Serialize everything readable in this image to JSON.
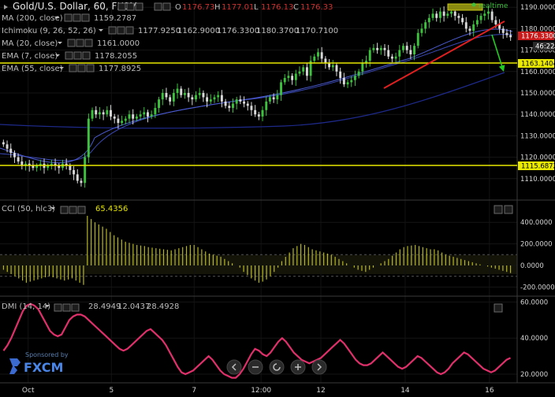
{
  "header": {
    "symbol": "Gold/U.S. Dollar, 60, FXCM",
    "ohlc": [
      {
        "key": "O",
        "value": "1176.73"
      },
      {
        "key": "H",
        "value": "1177.01"
      },
      {
        "key": "L",
        "value": "1176.13"
      },
      {
        "key": "C",
        "value": "1176.33"
      }
    ],
    "realtime_label": "realtime"
  },
  "indicators": [
    {
      "label": "MA (200, close)",
      "values": [
        "1159.2787"
      ],
      "colors": [
        "#4a7fd0"
      ]
    },
    {
      "label": "Ichimoku (9, 26, 52, 26)",
      "values": [
        "1177.9250",
        "1162.9000",
        "1176.3300",
        "1180.3700",
        "1170.7100"
      ],
      "colors": [
        "#4a7fd0",
        "#d03030",
        "#3cc23c",
        "#3cc23c",
        "#d03030"
      ]
    },
    {
      "label": "MA (20, close)",
      "values": [
        "1161.0000"
      ],
      "colors": [
        "#4a7fd0"
      ]
    },
    {
      "label": "EMA (7, close)",
      "values": [
        "1178.2055"
      ],
      "colors": [
        "#4a7fd0"
      ]
    },
    {
      "label": "EMA (55, close)",
      "values": [
        "1177.8925"
      ],
      "colors": [
        "#4a7fd0"
      ]
    }
  ],
  "price_axis": {
    "ticks": [
      "1190.0000",
      "1180.0000",
      "1170.0000",
      "1160.0000",
      "1150.0000",
      "1140.0000",
      "1130.0000",
      "1120.0000",
      "1110.0000"
    ],
    "current_price": "1176.3300",
    "countdown": "46:22",
    "hline_upper": "1163.1404",
    "hline_lower": "1115.6872"
  },
  "cci": {
    "label": "CCI (50, hlc3)",
    "value": "65.4356",
    "ticks": [
      "400.0000",
      "200.0000",
      "0.0000",
      "-200.0000"
    ]
  },
  "dmi": {
    "label": "DMI (14, 14)",
    "values": [
      "28.4949",
      "12.0437",
      "28.4928"
    ],
    "colors": [
      "#e0306c",
      "#4a7fd0",
      "#e88a2a"
    ],
    "ticks": [
      "60.0000",
      "40.0000",
      "20.0000"
    ]
  },
  "x_axis": {
    "ticks": [
      "Oct",
      "5",
      "7",
      "12:00",
      "12",
      "14",
      "16"
    ]
  },
  "sponsor": {
    "text": "Sponsored by",
    "brand": "FXCM"
  },
  "colors": {
    "up_candle": "#3cc23c",
    "down_candle": "#d8d8d8",
    "hline": "#e8e800",
    "trendline": "#e02020",
    "arrow": "#22cc22",
    "dmi_line": "#e0306c",
    "cci_bars": "#b8b81e"
  },
  "chart_data": [
    {
      "type": "candlestick",
      "title": "Gold/U.S. Dollar, 60, FXCM",
      "ylim": [
        1104,
        1193
      ],
      "x": [
        "Oct",
        "5",
        "7",
        "12:00",
        "12",
        "14",
        "16"
      ],
      "close": [
        1126,
        1124,
        1122,
        1120,
        1118,
        1116,
        1117,
        1116,
        1115,
        1116,
        1117,
        1115,
        1116,
        1117,
        1116,
        1115,
        1117,
        1116,
        1114,
        1112,
        1109,
        1108,
        1120,
        1138,
        1142,
        1140,
        1141,
        1140,
        1142,
        1139,
        1138,
        1136,
        1137,
        1138,
        1140,
        1138,
        1139,
        1140,
        1141,
        1139,
        1140,
        1143,
        1147,
        1150,
        1148,
        1146,
        1150,
        1152,
        1149,
        1150,
        1148,
        1147,
        1149,
        1150,
        1148,
        1146,
        1147,
        1148,
        1149,
        1146,
        1144,
        1143,
        1145,
        1147,
        1146,
        1145,
        1144,
        1142,
        1140,
        1139,
        1142,
        1146,
        1148,
        1147,
        1149,
        1155,
        1157,
        1158,
        1156,
        1159,
        1160,
        1162,
        1158,
        1165,
        1167,
        1169,
        1166,
        1164,
        1162,
        1163,
        1160,
        1157,
        1154,
        1155,
        1156,
        1158,
        1160,
        1164,
        1165,
        1170,
        1171,
        1170,
        1171,
        1170,
        1167,
        1166,
        1167,
        1170,
        1172,
        1170,
        1168,
        1172,
        1178,
        1180,
        1183,
        1185,
        1187,
        1185,
        1188,
        1186,
        1187,
        1188,
        1186,
        1185,
        1183,
        1180,
        1179,
        1182,
        1184,
        1186,
        1187,
        1188,
        1184,
        1182,
        1180,
        1178,
        1177,
        1176
      ],
      "hlines": [
        1163.1404,
        1115.6872
      ]
    },
    {
      "type": "bar",
      "title": "CCI (50, hlc3)",
      "ylim": [
        -250,
        480
      ],
      "values": [
        -40,
        -60,
        -80,
        -100,
        -120,
        -140,
        -160,
        -150,
        -140,
        -130,
        -120,
        -110,
        -100,
        -110,
        -120,
        -130,
        -140,
        -130,
        -120,
        -140,
        -160,
        -180,
        460,
        430,
        400,
        380,
        360,
        340,
        310,
        280,
        260,
        240,
        220,
        210,
        200,
        190,
        185,
        180,
        170,
        165,
        160,
        155,
        150,
        145,
        140,
        150,
        160,
        170,
        180,
        190,
        190,
        170,
        150,
        130,
        110,
        100,
        90,
        80,
        60,
        40,
        20,
        0,
        -20,
        -60,
        -90,
        -120,
        -140,
        -160,
        -150,
        -130,
        -100,
        -60,
        -20,
        40,
        80,
        120,
        160,
        180,
        200,
        190,
        170,
        150,
        140,
        130,
        120,
        110,
        100,
        80,
        60,
        40,
        20,
        0,
        -20,
        -40,
        -50,
        -60,
        -40,
        -20,
        0,
        20,
        40,
        60,
        90,
        120,
        150,
        170,
        180,
        185,
        190,
        180,
        170,
        160,
        150,
        150,
        140,
        120,
        100,
        90,
        80,
        70,
        60,
        50,
        40,
        30,
        20,
        10,
        0,
        -10,
        -20,
        -30,
        -40,
        -50,
        -60,
        -70
      ]
    },
    {
      "type": "line",
      "title": "DMI (14, 14)",
      "ylim": [
        12,
        62
      ],
      "values": [
        33,
        36,
        40,
        45,
        50,
        55,
        58,
        59,
        58,
        56,
        52,
        48,
        44,
        42,
        41,
        42,
        46,
        50,
        52,
        53,
        53,
        52,
        50,
        48,
        46,
        44,
        42,
        40,
        38,
        36,
        34,
        33,
        34,
        36,
        38,
        40,
        42,
        44,
        45,
        43,
        41,
        39,
        36,
        32,
        28,
        24,
        21,
        20,
        21,
        22,
        24,
        26,
        28,
        30,
        28,
        25,
        22,
        20,
        19,
        18,
        18,
        20,
        23,
        27,
        31,
        34,
        33,
        31,
        30,
        32,
        35,
        38,
        40,
        38,
        35,
        32,
        30,
        28,
        27,
        26,
        27,
        28,
        29,
        31,
        33,
        35,
        37,
        39,
        37,
        34,
        31,
        28,
        26,
        25,
        25,
        26,
        28,
        30,
        32,
        30,
        28,
        26,
        24,
        23,
        24,
        26,
        28,
        30,
        29,
        27,
        25,
        23,
        21,
        20,
        21,
        23,
        26,
        28,
        30,
        32,
        31,
        29,
        27,
        25,
        23,
        22,
        21,
        22,
        24,
        26,
        28,
        29
      ]
    }
  ]
}
